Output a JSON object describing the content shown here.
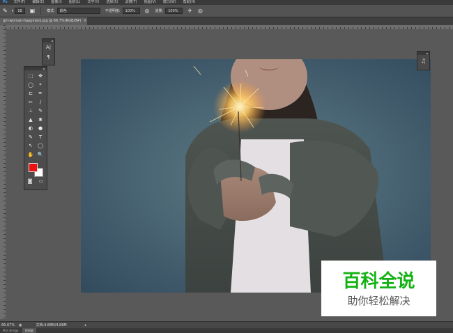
{
  "app": {
    "logo": "Ps"
  },
  "menu": {
    "items": [
      "文件(F)",
      "编辑(E)",
      "图像(I)",
      "图层(L)",
      "文字(Y)",
      "选择(S)",
      "滤镜(T)",
      "视图(V)",
      "窗口(W)",
      "帮助(H)"
    ]
  },
  "options": {
    "brush_size": "18",
    "mode_label": "模式:",
    "mode_value": "颜色",
    "opacity_label": "不透明度:",
    "opacity_value": "100%",
    "flow_label": "流量:",
    "flow_value": "100%"
  },
  "document": {
    "tab_title": "girl-woman-happiness.jpg @ 66.7%(RGB/8#)",
    "close": "×"
  },
  "panels": {
    "mini": {
      "btn1": "A|",
      "btn2": "¶"
    },
    "right": {
      "btn": "♫"
    }
  },
  "tools": [
    "⬚",
    "✥",
    "◯",
    "⌖",
    "⊏",
    "✒",
    "✂",
    "∕",
    "⊥",
    "✎",
    "▲",
    "✱",
    "◐",
    "●",
    "✎",
    "T",
    "↖",
    "◯",
    "✋",
    "🔍"
  ],
  "colors": {
    "foreground": "#ee1111",
    "background": "#ffffff"
  },
  "status": {
    "zoom": "66.67%",
    "doc_info": "文档:4.88M/4.88M"
  },
  "bottom_tabs": [
    "Mini Bridge",
    "时间轴"
  ],
  "watermark": {
    "title": "百科全说",
    "subtitle": "助你轻松解决"
  }
}
